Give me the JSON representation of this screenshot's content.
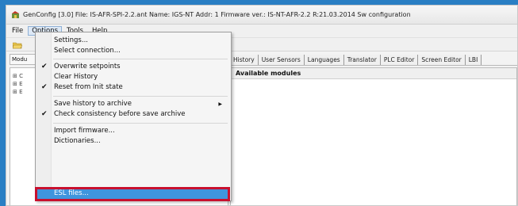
{
  "window": {
    "title": "GenConfig [3.0]  File: IS-AFR-SPI-2.2.ant  Name: IGS-NT  Addr: 1  Firmware ver.: IS-NT-AFR-2.2 R:21.03.2014  Sw configuration"
  },
  "menubar": {
    "items": [
      {
        "label": "File"
      },
      {
        "label": "Options"
      },
      {
        "label": "Tools"
      },
      {
        "label": "Help"
      }
    ]
  },
  "left_tab": {
    "label": "Modu"
  },
  "tabs": [
    {
      "label": "History"
    },
    {
      "label": "User Sensors"
    },
    {
      "label": "Languages"
    },
    {
      "label": "Translator"
    },
    {
      "label": "PLC Editor"
    },
    {
      "label": "Screen Editor"
    },
    {
      "label": "LBI"
    }
  ],
  "right_panel": {
    "header": "Available modules"
  },
  "tree": {
    "rows": [
      {
        "label": "⊞ C"
      },
      {
        "label": "⊞ E"
      },
      {
        "label": "⊞ E"
      }
    ]
  },
  "options_menu": {
    "items": [
      {
        "label": "Settings...",
        "checked": false,
        "submenu": false
      },
      {
        "label": "Select connection...",
        "checked": false,
        "submenu": false
      },
      {
        "label": "Overwrite setpoints",
        "checked": true,
        "submenu": false
      },
      {
        "label": "Clear History",
        "checked": false,
        "submenu": false
      },
      {
        "label": "Reset from Init state",
        "checked": true,
        "submenu": false
      },
      {
        "label": "Save history to archive",
        "checked": false,
        "submenu": true
      },
      {
        "label": "Check consistency before save archive",
        "checked": true,
        "submenu": false
      },
      {
        "label": "Import firmware...",
        "checked": false,
        "submenu": false
      },
      {
        "label": "Dictionaries...",
        "checked": false,
        "submenu": false
      },
      {
        "label": "ESL files...",
        "checked": false,
        "submenu": false,
        "selected": true
      }
    ],
    "check_glyph": "✔",
    "arrow_glyph": "▶"
  },
  "colors": {
    "background": "#2a7fc4",
    "selection": "#3f95dd",
    "highlight_border": "#c8102e"
  },
  "icons": {
    "app": "genconfig-app-icon",
    "toolbar_open": "open-folder-icon"
  }
}
